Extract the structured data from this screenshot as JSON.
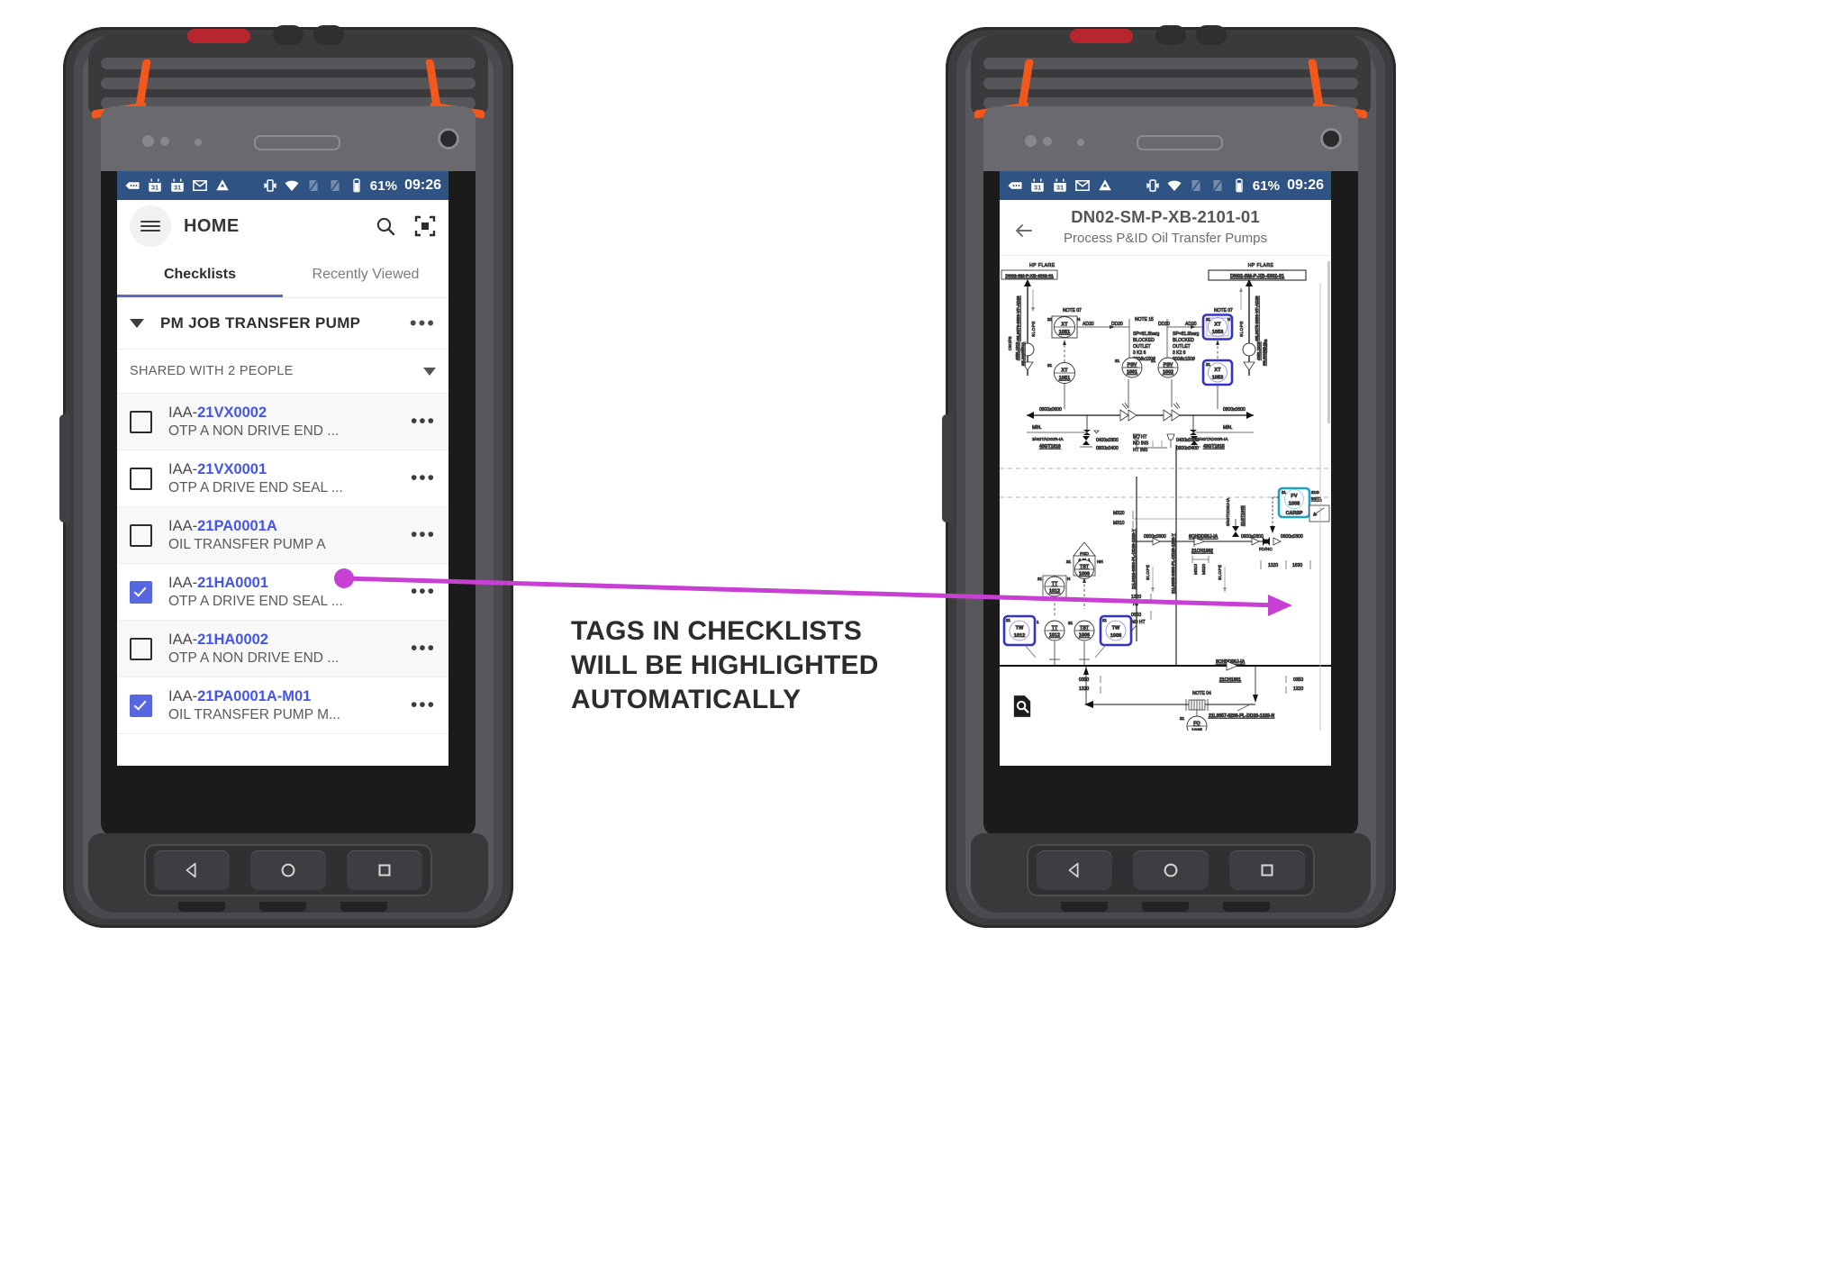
{
  "annotation": {
    "line1": "TAGS IN CHECKLISTS",
    "line2": "WILL BE HIGHLIGHTED",
    "line3": "AUTOMATICALLY",
    "arrow_color": "#c83fd4"
  },
  "theme": {
    "status_bar": "#2f5484",
    "accent_blue": "#5667e0",
    "tag_blue": "#4455e8",
    "tab_indicator": "#5c6bc0",
    "device_orange": "#f2571b",
    "highlight_blue": "#3333cc",
    "highlight_cyan": "#1aa3c8"
  },
  "status_bar": {
    "icons": [
      "messages-icon",
      "calendar-icon",
      "calendar-icon",
      "gmail-icon",
      "drive-icon",
      "vibrate-icon",
      "wifi-icon",
      "sim1-icon",
      "sim2-icon",
      "battery-icon"
    ],
    "battery": "61%",
    "time": "09:26"
  },
  "left_phone": {
    "appbar": {
      "menu_icon": "hamburger-icon",
      "title": "HOME",
      "search_icon": "search-icon",
      "scan_icon": "scan-qr-icon"
    },
    "tabs": [
      {
        "label": "Checklists",
        "active": true
      },
      {
        "label": "Recently Viewed",
        "active": false
      }
    ],
    "section": {
      "title": "PM JOB TRANSFER PUMP",
      "overflow": "•••",
      "expanded": true
    },
    "shared": {
      "label": "SHARED WITH 2 PEOPLE"
    },
    "items": [
      {
        "prefix": "IAA-",
        "tag": "21VX0002",
        "desc": "OTP A NON DRIVE END ...",
        "checked": false
      },
      {
        "prefix": "IAA-",
        "tag": "21VX0001",
        "desc": "OTP A DRIVE END SEAL ...",
        "checked": false
      },
      {
        "prefix": "IAA-",
        "tag": "21PA0001A",
        "desc": "OIL TRANSFER PUMP A",
        "checked": false
      },
      {
        "prefix": "IAA-",
        "tag": "21HA0001",
        "desc": "OTP A DRIVE END SEAL ...",
        "checked": true
      },
      {
        "prefix": "IAA-",
        "tag": "21HA0002",
        "desc": "OTP A NON DRIVE END ...",
        "checked": false
      },
      {
        "prefix": "IAA-",
        "tag": "21PA0001A-M01",
        "desc": "OIL TRANSFER PUMP M...",
        "checked": true
      }
    ],
    "nav": {
      "back": "back-triangle-icon",
      "home": "home-circle-icon",
      "recents": "recents-square-icon"
    }
  },
  "right_phone": {
    "header": {
      "back_icon": "back-arrow-icon",
      "doc_number": "DN02-SM-P-XB-2101-01",
      "doc_title": "Process P&ID Oil Transfer Pumps"
    },
    "find_icon": "document-search-icon",
    "drawing": {
      "flare_label_left": "HP FLARE",
      "flare_label_right": "HP FLARE",
      "flare_ref_left": "DN02-SM-P-XB-4302-01",
      "flare_ref_right": "DN02-SM-P-XB-4302-01",
      "note_07_left": "NOTE 07",
      "note_07_right": "NOTE 07",
      "note_15": "NOTE 15",
      "note_04": "NOTE 04",
      "slope_left": "SLOPE",
      "slope_right": "SLOPE",
      "line_left": "43L0076-0800-VF-AD20",
      "line_right": "43L0075-0800-VF-AD20",
      "valve_left": "43BL1019",
      "valve_right": "43BL1018",
      "csofb_left": "CSO/FB",
      "csofb_right": "CSO/FB",
      "drain_left": "88L20150R-IA",
      "drain_right": "88L20150R-IA",
      "sp_block_left": [
        "SP=81.8barg",
        "BLOCKED",
        "OUTLET",
        "3 K2 6",
        "900#x150#"
      ],
      "sp_block_right": [
        "SP=81.8barg",
        "BLOCKED",
        "OUTLET",
        "3 K2 6",
        "900#x150#"
      ],
      "ht_block": [
        "NO HT",
        "NO INS",
        "HT INS"
      ],
      "ad20_a": "AD20",
      "dd20_a": "DD20",
      "dd20_b": "DD20",
      "ad20_b": "AD20",
      "size_0800x0600_l": "0800x0600",
      "size_0800x0600_r": "0800x0600",
      "min_left": "MIN.",
      "min_right": "MIN.",
      "gt_left_line": "3/4GTAD00R-IA",
      "gt_left_tag": "43GT1016",
      "gt_right_line": "3/4GTAD00R-IA",
      "gt_right_tag": "43GT1015",
      "size_0400x0300_l": "0400x0300",
      "size_0800x0400_l": "0800x0400",
      "size_0400x0300_r": "0400x0300",
      "size_0800x0400_r": "0800x0400",
      "m320_a": "M320",
      "m310_a": "M310",
      "m310_b": "M310",
      "m320_b": "M320",
      "size_0800x0600_mid": "0800x0600",
      "pipe_v1": "21L0026-0800-PL-DD20-1320-Y",
      "pipe_v2": "21L0005-0600-PL-DD20-1320-Y",
      "slope_v1": "SLOPE",
      "slope_v2": "SLOPE",
      "check_6ch": "6CHDD50J-IA",
      "check_6ch_tag": "21CH1002",
      "check_8ch": "8CHDD50J-IA",
      "check_8ch_tag": "21CH1001",
      "gt_mid_line": "3/4GTDD00J-IA",
      "gt_mid_tag": "21GT1005",
      "fdnc": "FD/NC",
      "size_0600x0300_a": "0600x0300",
      "size_0600x0300_b": "0600x0300",
      "dim_1320": "1320",
      "dim_1630": "1630",
      "psd_label": "PSD",
      "psd_value": "4.21.1",
      "dim_1320_ht": "1320",
      "dim_ht": "HT",
      "dim_0350": "0350",
      "dim_noht": "NO HT",
      "dim_0350_b": "0350",
      "dim_1320_b": "1320",
      "dim_0350_c": "0350",
      "dim_1320_c": "1320",
      "pipe_bottom": "21L0057-0200-PL-DD20-1320-N",
      "fo_tag": "FO",
      "fo_num": "1035",
      "instruments": [
        {
          "type": "XT",
          "num": "1051",
          "highlight": "none"
        },
        {
          "type": "XT",
          "num": "1051",
          "highlight": "none"
        },
        {
          "type": "XT",
          "num": "1053",
          "highlight": "blue"
        },
        {
          "type": "XT",
          "num": "1053",
          "highlight": "blue"
        },
        {
          "type": "PSV",
          "num": "1001",
          "highlight": "none"
        },
        {
          "type": "PSV",
          "num": "1002",
          "highlight": "none"
        },
        {
          "type": "TST",
          "num": "1006",
          "highlight": "none"
        },
        {
          "type": "TT",
          "num": "1012",
          "highlight": "none"
        },
        {
          "type": "TT",
          "num": "1012",
          "highlight": "none"
        },
        {
          "type": "TST",
          "num": "1006",
          "highlight": "none"
        },
        {
          "type": "TW",
          "num": "1012",
          "highlight": "blue"
        },
        {
          "type": "TW",
          "num": "1006",
          "highlight": "blue"
        },
        {
          "type": "FV",
          "num": "1008",
          "highlight": "cyan",
          "suffix": "CARSP"
        },
        {
          "type": "FO",
          "num": "1035",
          "highlight": "none"
        }
      ],
      "loop_prefix": "21",
      "mod_h": "H",
      "mod_hh": "HH"
    },
    "nav": {
      "back": "back-triangle-icon",
      "home": "home-circle-icon",
      "recents": "recents-square-icon"
    }
  }
}
